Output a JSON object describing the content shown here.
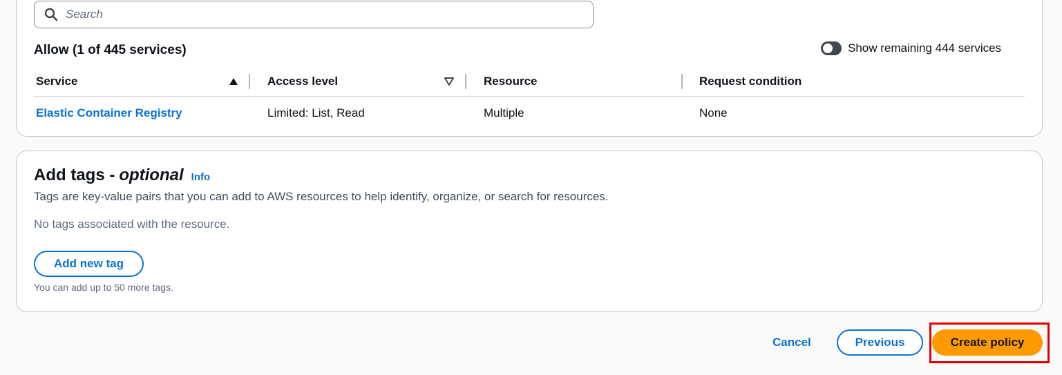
{
  "search": {
    "placeholder": "Search"
  },
  "services_panel": {
    "title": "Allow (1 of 445 services)",
    "toggle_label": "Show remaining 444 services",
    "toggle_on": false,
    "columns": [
      "Service",
      "Access level",
      "Resource",
      "Request condition"
    ],
    "rows": [
      {
        "service": "Elastic Container Registry",
        "access_level": "Limited: List, Read",
        "resource": "Multiple",
        "request_condition": "None"
      }
    ]
  },
  "tags_panel": {
    "title": "Add tags -",
    "title_optional": "optional",
    "info_label": "Info",
    "description": "Tags are key-value pairs that you can add to AWS resources to help identify, organize, or search for resources.",
    "empty_text": "No tags associated with the resource.",
    "add_button": "Add new tag",
    "limit_text": "You can add up to 50 more tags."
  },
  "footer": {
    "cancel_label": "Cancel",
    "previous_label": "Previous",
    "create_label": "Create policy"
  },
  "colors": {
    "primary_blue": "#0972d3",
    "accent_orange": "#ff9900",
    "highlight_red": "#e00000"
  }
}
